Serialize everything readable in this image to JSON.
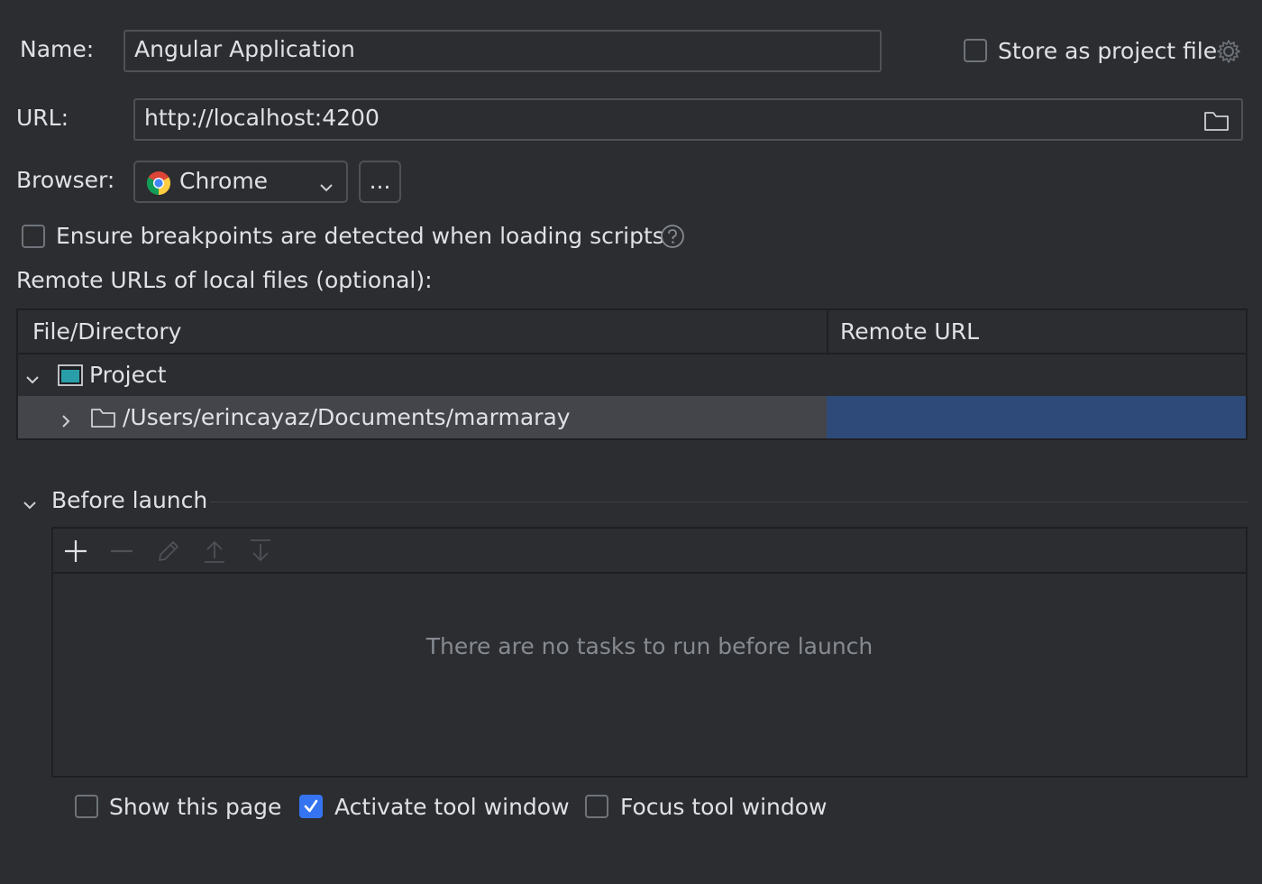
{
  "name_row": {
    "label": "Name:",
    "value": "Angular Application"
  },
  "store_as_project_file": {
    "label": "Store as project file",
    "checked": false,
    "icon": "gear-icon"
  },
  "url_row": {
    "label": "URL:",
    "value": "http://localhost:4200",
    "icon": "folder-icon"
  },
  "browser_row": {
    "label": "Browser:",
    "selected": "Chrome",
    "icon": "chrome-icon",
    "more_button_label": "..."
  },
  "ensure_breakpoints": {
    "label": "Ensure breakpoints are detected when loading scripts",
    "checked": false,
    "help_icon": "help-icon"
  },
  "remote_urls": {
    "label": "Remote URLs of local files (optional):",
    "columns": [
      "File/Directory",
      "Remote URL"
    ],
    "rows": [
      {
        "name": "Project",
        "expanded": true,
        "icon": "project-icon",
        "remote_url": ""
      },
      {
        "name": "/Users/erincayaz/Documents/marmaray",
        "expanded": false,
        "icon": "folder-icon",
        "remote_url": ""
      }
    ]
  },
  "before_launch": {
    "title": "Before launch",
    "toolbar": [
      "add-icon",
      "remove-icon",
      "edit-icon",
      "move-up-icon",
      "move-down-icon"
    ],
    "empty_text": "There are no tasks to run before launch"
  },
  "options": [
    {
      "label": "Show this page",
      "checked": false
    },
    {
      "label": "Activate tool window",
      "checked": true
    },
    {
      "label": "Focus tool window",
      "checked": false
    }
  ],
  "colors": {
    "background": "#2b2d30",
    "selection": "#2e4a78",
    "accent": "#3574f0"
  }
}
